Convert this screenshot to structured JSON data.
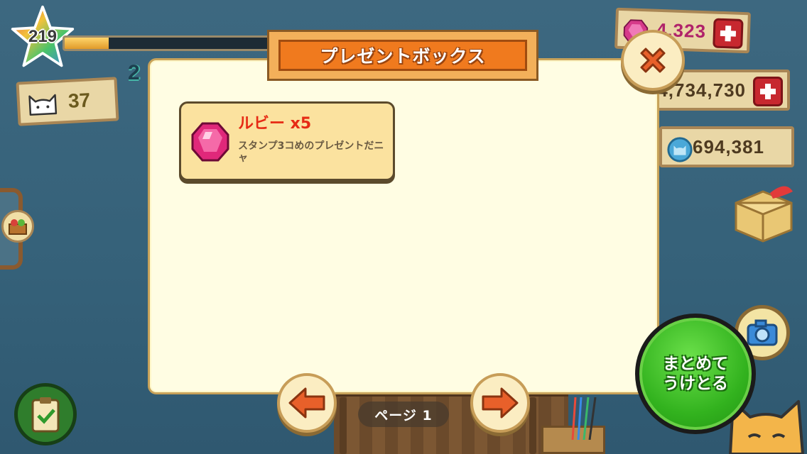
{
  "hud": {
    "level": "219",
    "xp_progress": 0.21,
    "xp_peek": "2",
    "cats": "37",
    "rubies": "4,323",
    "coins": "4,734,730",
    "fish_coins": "694,381"
  },
  "dialog": {
    "title": "プレゼントボックス",
    "items": [
      {
        "title": "ルビー x5",
        "description": "スタンプ3コめのプレゼントだニャ",
        "icon": "ruby-icon"
      }
    ],
    "page_label": "ページ 1",
    "collect_all_label": "まとめて\nうけとる"
  },
  "icons": {
    "level": "star-icon",
    "cats": "cat-icon",
    "rubies": "ruby-icon",
    "fish_coins": "cat-coin-icon",
    "gift": "gift-box-icon",
    "camera": "camera-icon",
    "clipboard": "clipboard-icon",
    "basket": "basket-icon",
    "close": "close-icon",
    "prev": "arrow-left-icon",
    "next": "arrow-right-icon"
  },
  "colors": {
    "accent_orange": "#f07a1e",
    "item_title_red": "#e62a14",
    "collect_green": "#32b21e",
    "plus_red": "#c7282f",
    "dialog_bg": "#fffde3"
  }
}
